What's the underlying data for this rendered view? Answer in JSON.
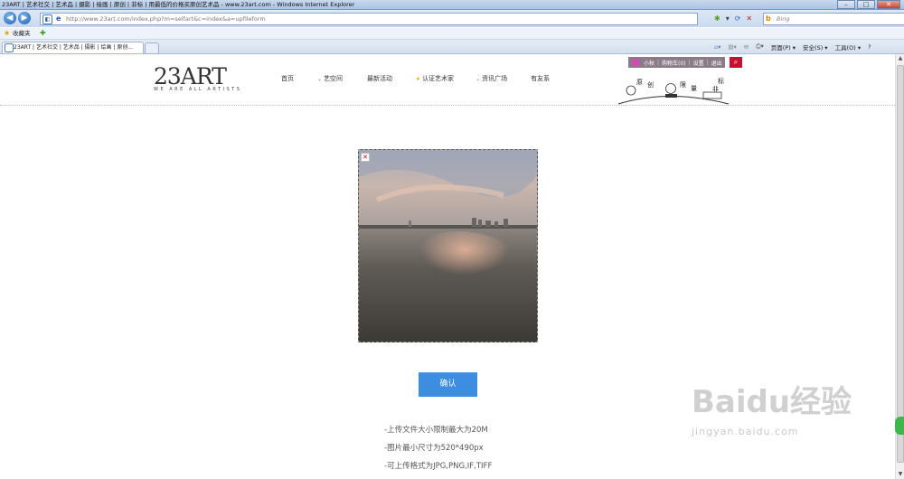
{
  "browser": {
    "window_title": "23ART | 艺术社交 | 艺术品 | 摄影 | 绘画 | 原创 | 非标 | 用最低的价格买原创艺术品 - www.23art.com - Windows Internet Explorer",
    "url": "http://www.23art.com/index.php?m=selfart&c=index&a=upfileform",
    "search_placeholder": "Bing",
    "favorites_label": "收藏夹",
    "tab_title": "23ART | 艺术社交 | 艺术品 | 摄影 | 绘画 | 原创...",
    "commands": [
      "页面(P) ▾",
      "安全(S) ▾",
      "工具(O) ▾",
      "?"
    ]
  },
  "site": {
    "logo": "23ART",
    "logo_tagline": "WE ARE ALL ARTISTS",
    "nav": [
      "首页",
      "艺空间",
      "最新活动",
      "认证艺术家",
      "资讯广场",
      "有友系"
    ],
    "user_bar": [
      "小秋",
      "购物车(0)",
      "设置",
      "退出"
    ],
    "deco_chars": [
      "原",
      "创",
      "限",
      "量",
      "标",
      "非"
    ]
  },
  "upload": {
    "remove_icon": "✕",
    "confirm_label": "确认",
    "notes": [
      "-上传文件大小限制最大为20M",
      "-图片最小尺寸为520*490px",
      "-可上传格式为JPG,PNG,IF,TIFF"
    ]
  },
  "watermark": {
    "text": "Baidu经验",
    "url": "jingyan.baidu.com"
  }
}
